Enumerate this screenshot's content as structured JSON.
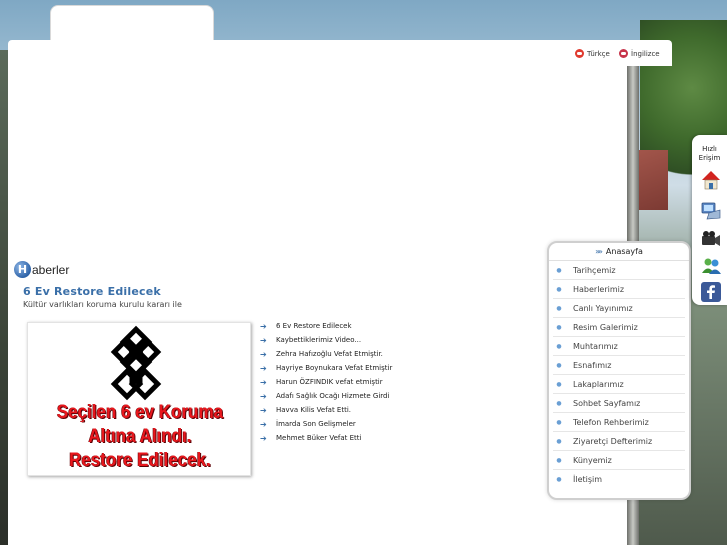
{
  "languages": [
    {
      "label": "Türkçe",
      "icon": "turkish-flag-icon"
    },
    {
      "label": "İngilizce",
      "icon": "english-flag-icon"
    }
  ],
  "news": {
    "badge": "H",
    "heading": "aberler",
    "featured_title": "6 Ev Restore Edilecek",
    "featured_summary": "Kültür varlıkları koruma kurulu kararı ile",
    "featured_image_lines": [
      "Seçilen 6 ev Koruma",
      "Altına Alındı.",
      "Restore Edilecek."
    ],
    "items": [
      "6 Ev Restore Edilecek",
      "Kaybettiklerimiz Video...",
      "Zehra Hafızoğlu Vefat Etmiştir.",
      "Hayriye Boynukara Vefat Etmiştir",
      "Harun ÖZFINDIK vefat etmiştir",
      "Adafı Sağlık Ocağı Hizmete Girdi",
      "Havva Kilis Vefat Etti.",
      "İmarda Son Gelişmeler",
      "Mehmet Büker Vefat Etti"
    ]
  },
  "menu": {
    "title": "Anasayfa",
    "items": [
      "Tarihçemiz",
      "Haberlerimiz",
      "Canlı Yayınımız",
      "Resim Galerimiz",
      "Muhtarımız",
      "Esnafımız",
      "Lakaplarımız",
      "Sohbet Sayfamız",
      "Telefon Rehberimiz",
      "Ziyaretçi Defterimiz",
      "Künyemiz",
      "İletişim"
    ]
  },
  "quick_access": {
    "title_line1": "Hızlı",
    "title_line2": "Erişim",
    "icons": [
      "home-icon",
      "computer-icon",
      "video-camera-icon",
      "messenger-icon",
      "facebook-icon"
    ]
  },
  "colors": {
    "accent_blue": "#3a6fa8",
    "image_text_red": "#e8171d",
    "facebook_blue": "#3b5998"
  }
}
